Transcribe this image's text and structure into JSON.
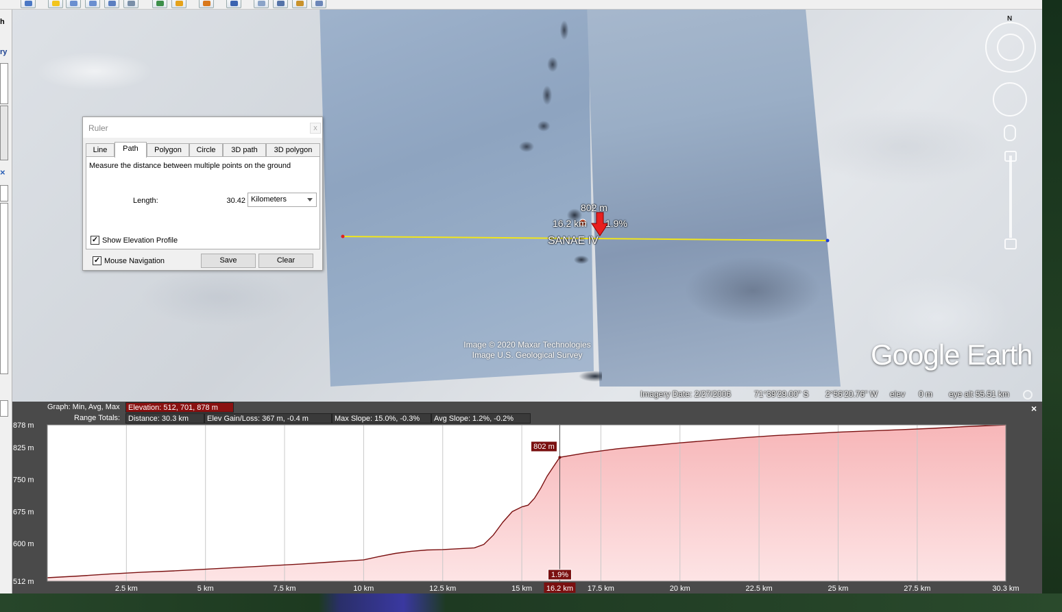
{
  "ruler": {
    "title": "Ruler",
    "close": "x",
    "tabs": [
      "Line",
      "Path",
      "Polygon",
      "Circle",
      "3D path",
      "3D polygon"
    ],
    "active_tab": "Path",
    "description": "Measure the distance between multiple points on the ground",
    "length_label": "Length:",
    "length_value": "30.42",
    "units": "Kilometers",
    "show_elevation_profile": "Show Elevation Profile",
    "mouse_navigation": "Mouse Navigation",
    "save": "Save",
    "clear": "Clear",
    "check": "✓"
  },
  "map": {
    "place_name": "SANAE IV",
    "hover_elev": "802 m",
    "hover_dist": "16.2 km",
    "hover_slope": "1.9%",
    "attribution_1": "Image © 2020 Maxar Technologies",
    "attribution_2": "Image U.S. Geological Survey",
    "logo": "Google Earth",
    "north": "N",
    "line_color": "#f2e61a"
  },
  "status": {
    "imagery_date": "Imagery Date: 2/27/2006",
    "lat": "71°39'29.00\" S",
    "lon": "2°56'20.76\" W",
    "elev_label": "elev",
    "elev_value": "0 m",
    "eye_alt": "eye alt  55.51 km"
  },
  "sidebar": {
    "t1": "h",
    "t2": "ry",
    "x": "×"
  },
  "profile": {
    "close": "×",
    "graph_label": "Graph: Min, Avg, Max",
    "elevation": "Elevation: 512, 701, 878 m",
    "range_totals_label": "Range Totals:",
    "distance": "Distance: 30.3 km",
    "gain_loss": "Elev Gain/Loss: 367 m, -0.4 m",
    "max_slope": "Max Slope: 15.0%, -0.3%",
    "avg_slope": "Avg Slope: 1.2%, -0.2%",
    "highlight_elev": "802 m",
    "highlight_slope": "1.9%",
    "highlight_dist": "16.2 km"
  },
  "chart_data": {
    "type": "area",
    "xlabel": "",
    "ylabel": "",
    "x_unit": "km",
    "xlim": [
      0,
      30.3
    ],
    "ylim": [
      512,
      878
    ],
    "x_ticks": [
      2.5,
      5,
      7.5,
      10,
      12.5,
      15,
      17.5,
      20,
      22.5,
      25,
      27.5,
      30.3
    ],
    "x_tick_labels": [
      "2.5 km",
      "5 km",
      "7.5 km",
      "10 km",
      "12.5 km",
      "15 km",
      "17.5 km",
      "20 km",
      "22.5 km",
      "25 km",
      "27.5 km",
      "30.3 km"
    ],
    "y_ticks": [
      512,
      600,
      675,
      750,
      825,
      878
    ],
    "y_tick_labels": [
      "512 m",
      "600 m",
      "675 m",
      "750 m",
      "825 m",
      "878 m"
    ],
    "highlight_x": 16.2,
    "fill_color": "#f7b6b8",
    "line_color": "#7a1010",
    "series": [
      {
        "x": [
          0,
          1,
          2,
          3,
          4,
          5,
          6,
          7,
          8,
          9,
          10,
          10.5,
          11,
          11.5,
          12,
          12.5,
          13,
          13.5,
          13.8,
          14.1,
          14.4,
          14.7,
          15,
          15.2,
          15.4,
          15.6,
          15.8,
          16,
          16.2,
          17,
          18,
          19,
          20,
          21,
          22,
          23,
          24,
          25,
          26,
          27,
          28,
          29,
          30.3
        ],
        "y": [
          520,
          524,
          529,
          533,
          536,
          540,
          544,
          548,
          552,
          557,
          562,
          570,
          577,
          582,
          585,
          586,
          588,
          590,
          598,
          620,
          650,
          675,
          686,
          690,
          706,
          730,
          758,
          780,
          802,
          812,
          822,
          829,
          836,
          842,
          848,
          853,
          857,
          861,
          864,
          867,
          870,
          874,
          878
        ]
      }
    ]
  }
}
